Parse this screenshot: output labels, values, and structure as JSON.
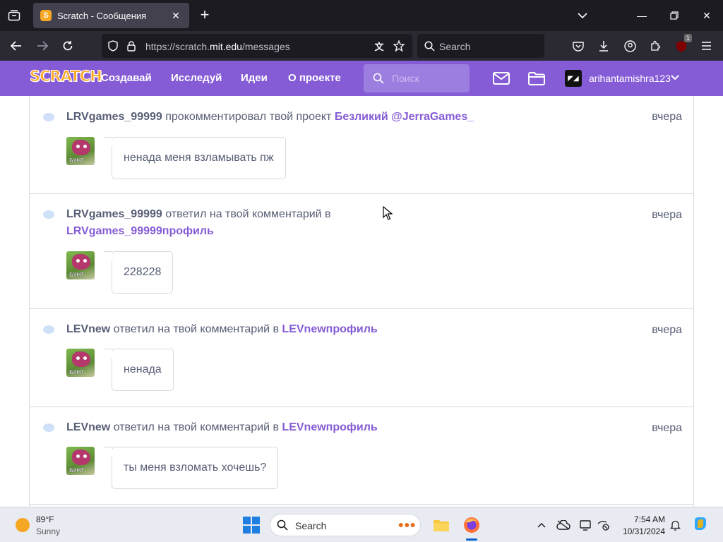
{
  "browser": {
    "tab": {
      "title": "Scratch - Сообщения",
      "favicon": "scratch-cat-favicon"
    },
    "url": {
      "prefix": "https://scratch.",
      "host": "mit.edu",
      "path": "/messages"
    },
    "search_placeholder": "Search",
    "extension_badge": "1"
  },
  "scratch_header": {
    "logo": "SCRATCH",
    "menu": [
      "Создавай",
      "Исследуй",
      "Идеи",
      "О проекте"
    ],
    "search_placeholder": "Поиск",
    "avatar_text": "◤◢",
    "username": "arihantamishra123"
  },
  "messages": [
    {
      "user": "LRVgames_99999",
      "action": " прокомментировал твой проект ",
      "link": "Безликий @JerraGames_",
      "time": "вчера",
      "comment": "ненада меня взламывать пж",
      "thumb_tag": "БУНТ"
    },
    {
      "user": "LRVgames_99999",
      "action": " ответил на твой комментарий в ",
      "link": "LRVgames_99999профиль",
      "time": "вчера",
      "comment": "228228",
      "thumb_tag": "БУНТ"
    },
    {
      "user": "LEVnew",
      "action": " ответил на твой комментарий в ",
      "link": "LEVnewпрофиль",
      "time": "вчера",
      "comment": "ненада",
      "thumb_tag": "БУНТ"
    },
    {
      "user": "LEVnew",
      "action": " ответил на твой комментарий в ",
      "link": "LEVnewпрофиль",
      "time": "вчера",
      "comment": "ты меня взломать хочешь?",
      "thumb_tag": "БУНТ"
    }
  ],
  "taskbar": {
    "weather": {
      "temp": "89°F",
      "condition": "Sunny"
    },
    "search_placeholder": "Search",
    "clock": {
      "time": "7:54 AM",
      "date": "10/31/2024"
    }
  },
  "colors": {
    "scratch_purple": "#855cd6",
    "text": "#575e75",
    "link": "#855cd6",
    "browser_dark": "#1c1b22"
  }
}
